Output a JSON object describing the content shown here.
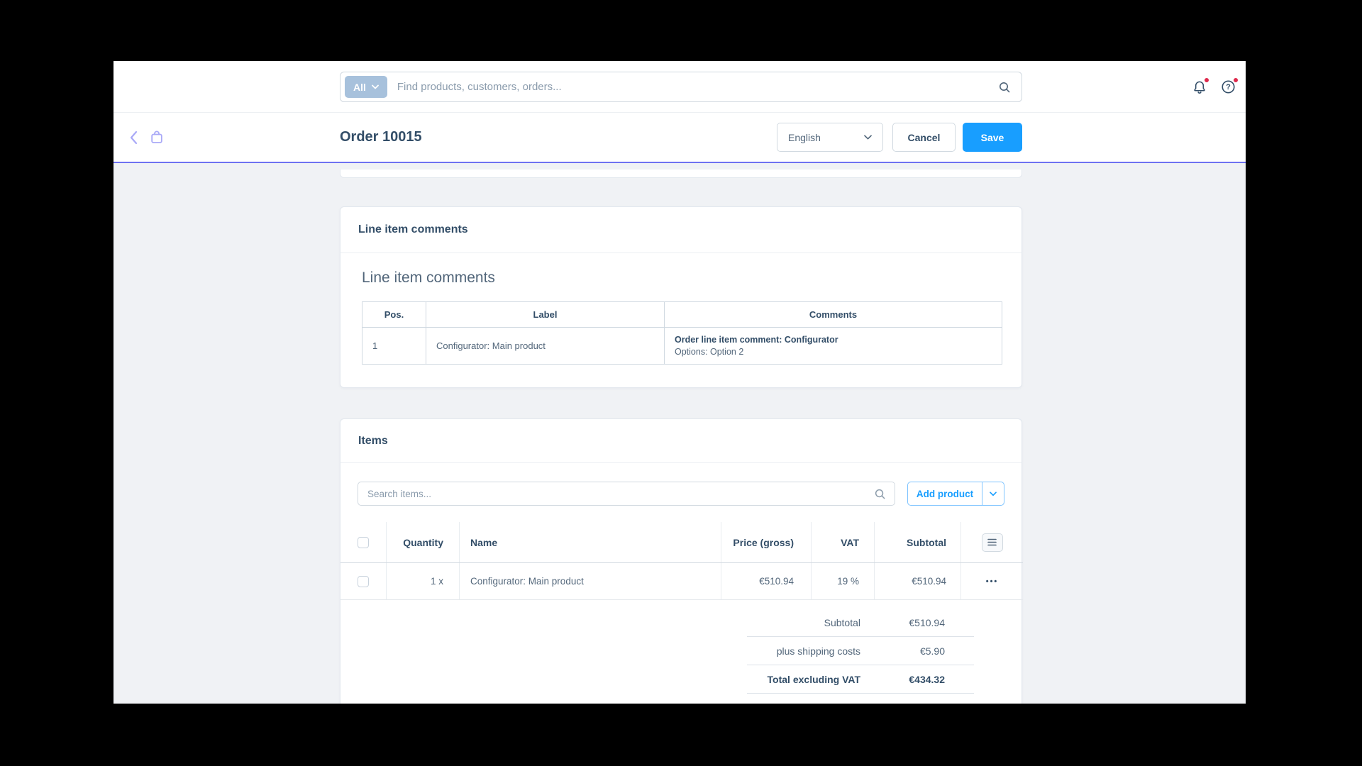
{
  "colors": {
    "primary_blue": "#189eff",
    "module_accent_purple": "#a9a9f7",
    "smartbar_border": "#6e72f2",
    "notification_red": "#de294c",
    "scope_badge_blue": "#a7c1dc"
  },
  "topbar": {
    "scope_label": "All",
    "search_placeholder": "Find products, customers, orders..."
  },
  "smartbar": {
    "title": "Order 10015",
    "language": "English",
    "cancel": "Cancel",
    "save": "Save"
  },
  "comments_card": {
    "title": "Line item comments",
    "section_title": "Line item comments",
    "columns": {
      "pos": "Pos.",
      "label": "Label",
      "comments": "Comments"
    },
    "rows": [
      {
        "pos": "1",
        "label": "Configurator: Main product",
        "comment_title": "Order line item comment: Configurator",
        "comment_detail": "Options: Option 2"
      }
    ]
  },
  "items_card": {
    "title": "Items",
    "search_placeholder": "Search items...",
    "add_product": "Add product",
    "columns": {
      "quantity": "Quantity",
      "name": "Name",
      "price": "Price (gross)",
      "vat": "VAT",
      "subtotal": "Subtotal"
    },
    "rows": [
      {
        "quantity": "1 x",
        "name": "Configurator: Main product",
        "price": "€510.94",
        "vat": "19 %",
        "subtotal": "€510.94"
      }
    ],
    "summary": [
      {
        "label": "Subtotal",
        "value": "€510.94"
      },
      {
        "label": "plus shipping costs",
        "value": "€5.90"
      },
      {
        "label": "Total excluding VAT",
        "value": "€434.32"
      }
    ]
  },
  "icons": {
    "help_glyph": "?",
    "context_menu_glyph": "•••"
  }
}
